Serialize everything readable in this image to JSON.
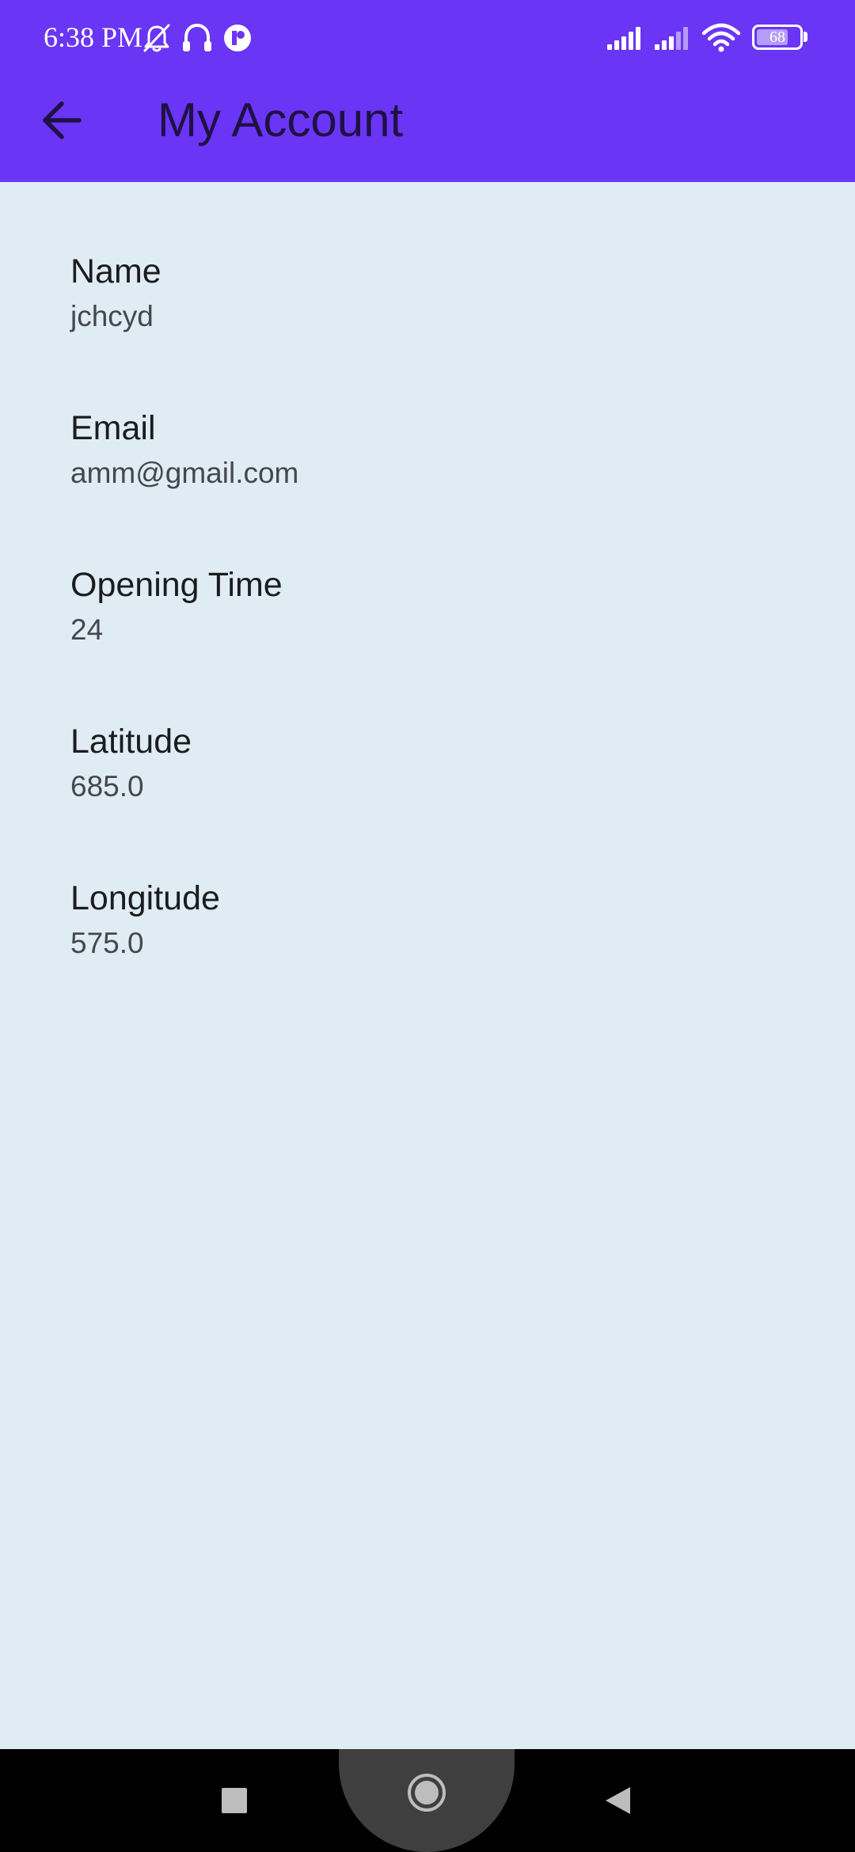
{
  "status_bar": {
    "time": "6:38 PM",
    "battery_level": "68",
    "icons": [
      "bell-off-icon",
      "headphones-icon",
      "app-notification-icon",
      "signal-icon",
      "signal-icon",
      "wifi-icon",
      "battery-icon"
    ]
  },
  "header": {
    "title": "My Account",
    "back_icon": "arrow-left-icon",
    "background_color": "#6a35f4",
    "title_color": "#1f1145"
  },
  "account": {
    "fields": [
      {
        "label": "Name",
        "value": "jchcyd"
      },
      {
        "label": "Email",
        "value": "amm@gmail.com"
      },
      {
        "label": "Opening Time",
        "value": "24"
      },
      {
        "label": "Latitude",
        "value": "685.0"
      },
      {
        "label": "Longitude",
        "value": "575.0"
      }
    ]
  },
  "nav_bar": {
    "buttons": [
      "recents-square-icon",
      "home-circle-icon",
      "back-triangle-icon"
    ]
  },
  "colors": {
    "page_background": "#e0ecf4",
    "label": "#1a1c1e",
    "value": "#44474e"
  }
}
